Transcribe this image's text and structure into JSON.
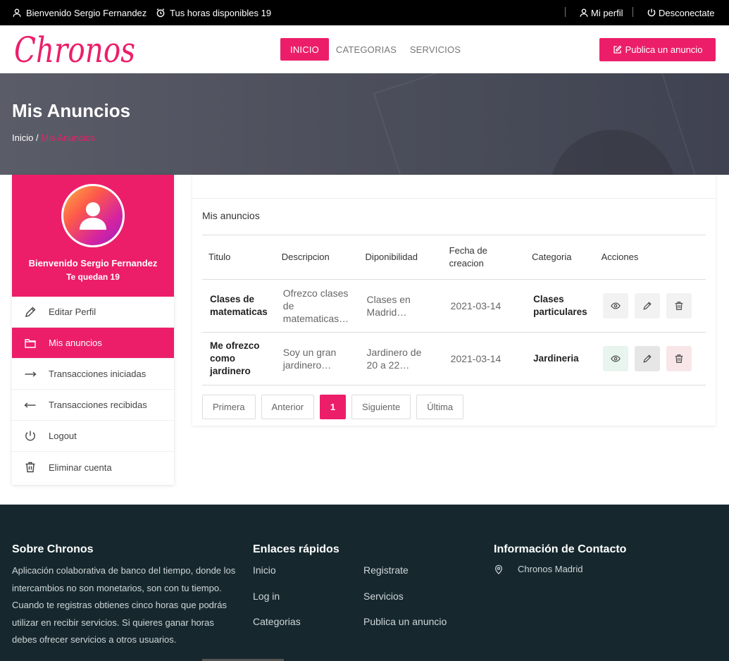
{
  "topbar": {
    "welcome": "Bienvenido Sergio Fernandez",
    "hours": "Tus horas disponibles 19",
    "profile": "Mi perfil",
    "logout": "Desconectate"
  },
  "brand": {
    "logo_text": "Chronos",
    "accent": "#ec1e69"
  },
  "nav": {
    "home": "INICIO",
    "categories": "CATEGORIAS",
    "services": "SERVICIOS",
    "publish": "Publica un anuncio"
  },
  "hero": {
    "title": "Mis Anuncios",
    "crumb_home": "Inicio",
    "crumb_sep": "/",
    "crumb_current": "Mis Anuncios"
  },
  "sidebar": {
    "welcome": "Bienvenido Sergio Fernandez",
    "remaining": "Te quedan 19",
    "items": [
      {
        "label": "Editar Perfil",
        "icon": "pencil-icon"
      },
      {
        "label": "Mis anuncios",
        "icon": "folder-icon"
      },
      {
        "label": "Transacciones iniciadas",
        "icon": "arrow-right-icon"
      },
      {
        "label": "Transacciones recibidas",
        "icon": "arrow-left-icon"
      },
      {
        "label": "Logout",
        "icon": "power-icon"
      },
      {
        "label": "Eliminar cuenta",
        "icon": "trash-icon"
      }
    ]
  },
  "ads": {
    "title": "Mis anuncios",
    "columns": [
      "Titulo",
      "Descripcion",
      "Diponibilidad",
      "Fecha de creacion",
      "Categoria",
      "Acciones"
    ],
    "rows": [
      {
        "title": "Clases de matematicas",
        "description": "Ofrezco clases de matematicas…",
        "availability": "Clases en Madrid…",
        "created": "2021-03-14",
        "category": "Clases particulares"
      },
      {
        "title": "Me ofrezco como jardinero",
        "description": "Soy un gran jardinero…",
        "availability": "Jardinero de 20 a 22…",
        "created": "2021-03-14",
        "category": "Jardineria"
      }
    ]
  },
  "pager": {
    "first": "Primera",
    "prev": "Anterior",
    "current": "1",
    "next": "Siguiente",
    "last": "Última"
  },
  "footer": {
    "about_title": "Sobre Chronos",
    "about_text": "Aplicación colaborativa de banco del tiempo, donde los intercambios no son monetarios, son con tu tiempo. Cuando te registras obtienes cinco horas que podrás utilizar en recibir servicios. Si quieres ganar horas debes ofrecer servicios a otros usuarios.",
    "links_title": "Enlaces rápidos",
    "links": [
      "Inicio",
      "Registrate",
      "Log in",
      "Servicios",
      "Categorias",
      "Publica un anuncio"
    ],
    "contact_title": "Información de Contacto",
    "contact_location": "Chronos Madrid"
  }
}
